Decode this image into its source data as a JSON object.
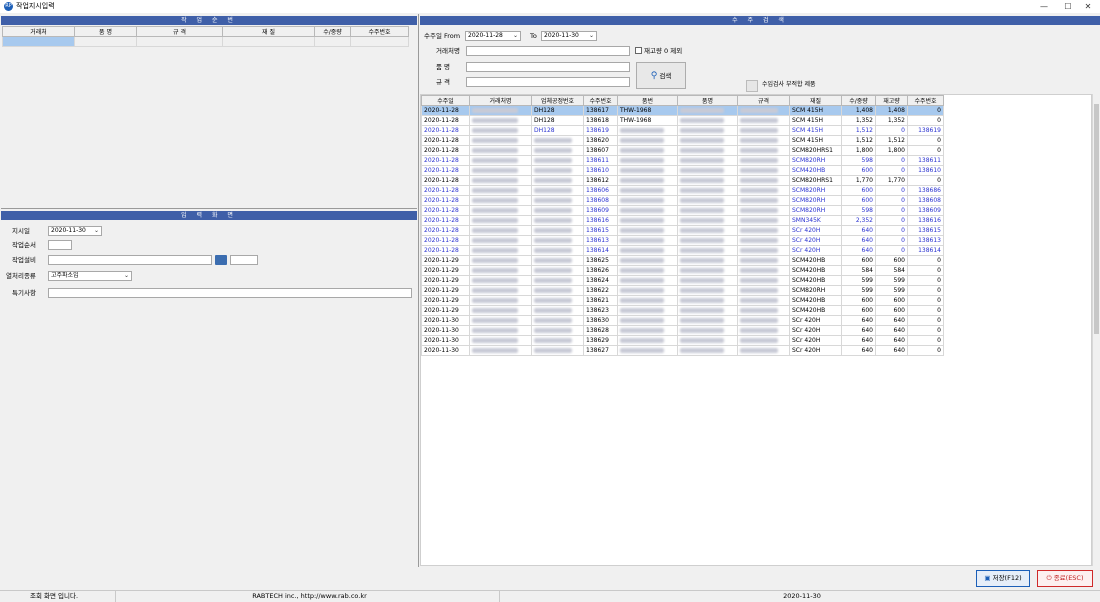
{
  "window": {
    "title": "작업지시입력",
    "icon_label": "RP",
    "min": "—",
    "max": "☐",
    "close": "✕"
  },
  "left_top_panel": {
    "title": "작 업 순 번",
    "columns": [
      "거래처",
      "품 명",
      "규 격",
      "재 질",
      "수/중량",
      "수주번호"
    ]
  },
  "left_bottom_panel": {
    "title": "입 력 화 면",
    "fields": {
      "date_label": "지시일",
      "date_value": "2020-11-30",
      "seq_label": "작업순서",
      "seq_value": "",
      "equip_label": "작업설비",
      "equip_value": "",
      "equip_extra": "",
      "heat_label": "열처리종류",
      "heat_value": "고주파소입",
      "note_label": "특기사항",
      "note_value": ""
    }
  },
  "right_panel": {
    "title": "수 주 검 색",
    "search": {
      "from_label": "수주일 From",
      "from_value": "2020-11-28",
      "to_label": "To",
      "to_value": "2020-11-30",
      "exclude_label": "재고량 0 제외",
      "customer_label": "거래처명",
      "customer_value": "",
      "item_label": "품 명",
      "item_value": "",
      "spec_label": "규 격",
      "spec_value": "",
      "search_button": "검색",
      "check_label": "수입검사 부적합 제품"
    },
    "columns": [
      "수주일",
      "거래처명",
      "업체공정번호",
      "수주번호",
      "품번",
      "품명",
      "규격",
      "재질",
      "수/중량",
      "재고량",
      "수주번호"
    ],
    "rows": [
      {
        "date": "2020-11-28",
        "proc": "DH128",
        "order": "138617",
        "part": "THW-1968",
        "material": "SCM 415H",
        "qty": "1,408",
        "stock": "1,408",
        "ord2": "0",
        "style": "sel"
      },
      {
        "date": "2020-11-28",
        "proc": "DH128",
        "order": "138618",
        "part": "THW-1968",
        "material": "SCM 415H",
        "qty": "1,352",
        "stock": "1,352",
        "ord2": "0",
        "style": ""
      },
      {
        "date": "2020-11-28",
        "proc": "DH128",
        "order": "138619",
        "part": "",
        "material": "SCM 415H",
        "qty": "1,512",
        "stock": "0",
        "ord2": "138619",
        "style": "blue"
      },
      {
        "date": "2020-11-28",
        "proc": "",
        "order": "138620",
        "part": "",
        "material": "SCM 415H",
        "qty": "1,512",
        "stock": "1,512",
        "ord2": "0",
        "style": ""
      },
      {
        "date": "2020-11-28",
        "proc": "",
        "order": "138607",
        "part": "",
        "material": "SCM820HRS1",
        "qty": "1,800",
        "stock": "1,800",
        "ord2": "0",
        "style": ""
      },
      {
        "date": "2020-11-28",
        "proc": "",
        "order": "138611",
        "part": "",
        "material": "SCM820RH",
        "qty": "598",
        "stock": "0",
        "ord2": "138611",
        "style": "blue"
      },
      {
        "date": "2020-11-28",
        "proc": "",
        "order": "138610",
        "part": "",
        "material": "SCM420HB",
        "qty": "600",
        "stock": "0",
        "ord2": "138610",
        "style": "blue"
      },
      {
        "date": "2020-11-28",
        "proc": "",
        "order": "138612",
        "part": "",
        "material": "SCM820HRS1",
        "qty": "1,770",
        "stock": "1,770",
        "ord2": "0",
        "style": ""
      },
      {
        "date": "2020-11-28",
        "proc": "",
        "order": "138606",
        "part": "",
        "material": "SCM820RH",
        "qty": "600",
        "stock": "0",
        "ord2": "138686",
        "style": "blue"
      },
      {
        "date": "2020-11-28",
        "proc": "",
        "order": "138608",
        "part": "",
        "material": "SCM820RH",
        "qty": "600",
        "stock": "0",
        "ord2": "138608",
        "style": "blue"
      },
      {
        "date": "2020-11-28",
        "proc": "",
        "order": "138609",
        "part": "",
        "material": "SCM820RH",
        "qty": "598",
        "stock": "0",
        "ord2": "138609",
        "style": "blue"
      },
      {
        "date": "2020-11-28",
        "proc": "",
        "order": "138616",
        "part": "",
        "material": "SMN345K",
        "qty": "2,352",
        "stock": "0",
        "ord2": "138616",
        "style": "blue"
      },
      {
        "date": "2020-11-28",
        "proc": "",
        "order": "138615",
        "part": "",
        "material": "SCr 420H",
        "qty": "640",
        "stock": "0",
        "ord2": "138615",
        "style": "blue"
      },
      {
        "date": "2020-11-28",
        "proc": "",
        "order": "138613",
        "part": "",
        "material": "SCr 420H",
        "qty": "640",
        "stock": "0",
        "ord2": "138613",
        "style": "blue"
      },
      {
        "date": "2020-11-28",
        "proc": "",
        "order": "138614",
        "part": "",
        "material": "SCr 420H",
        "qty": "640",
        "stock": "0",
        "ord2": "138614",
        "style": "blue"
      },
      {
        "date": "2020-11-29",
        "proc": "",
        "order": "138625",
        "part": "",
        "material": "SCM420HB",
        "qty": "600",
        "stock": "600",
        "ord2": "0",
        "style": ""
      },
      {
        "date": "2020-11-29",
        "proc": "",
        "order": "138626",
        "part": "",
        "material": "SCM420HB",
        "qty": "584",
        "stock": "584",
        "ord2": "0",
        "style": ""
      },
      {
        "date": "2020-11-29",
        "proc": "",
        "order": "138624",
        "part": "",
        "material": "SCM420HB",
        "qty": "599",
        "stock": "599",
        "ord2": "0",
        "style": ""
      },
      {
        "date": "2020-11-29",
        "proc": "",
        "order": "138622",
        "part": "",
        "material": "SCM820RH",
        "qty": "599",
        "stock": "599",
        "ord2": "0",
        "style": ""
      },
      {
        "date": "2020-11-29",
        "proc": "",
        "order": "138621",
        "part": "",
        "material": "SCM420HB",
        "qty": "600",
        "stock": "600",
        "ord2": "0",
        "style": ""
      },
      {
        "date": "2020-11-29",
        "proc": "",
        "order": "138623",
        "part": "",
        "material": "SCM420HB",
        "qty": "600",
        "stock": "600",
        "ord2": "0",
        "style": ""
      },
      {
        "date": "2020-11-30",
        "proc": "",
        "order": "138630",
        "part": "",
        "material": "SCr 420H",
        "qty": "640",
        "stock": "640",
        "ord2": "0",
        "style": ""
      },
      {
        "date": "2020-11-30",
        "proc": "",
        "order": "138628",
        "part": "",
        "material": "SCr 420H",
        "qty": "640",
        "stock": "640",
        "ord2": "0",
        "style": ""
      },
      {
        "date": "2020-11-30",
        "proc": "",
        "order": "138629",
        "part": "",
        "material": "SCr 420H",
        "qty": "640",
        "stock": "640",
        "ord2": "0",
        "style": ""
      },
      {
        "date": "2020-11-30",
        "proc": "",
        "order": "138627",
        "part": "",
        "material": "SCr 420H",
        "qty": "640",
        "stock": "640",
        "ord2": "0",
        "style": ""
      }
    ]
  },
  "buttons": {
    "save": "저장(F12)",
    "exit": "종료(ESC)"
  },
  "status": {
    "message": "조회 화면 입니다.",
    "company": "RABTECH inc., http://www.rab.co.kr",
    "date": "2020-11-30"
  }
}
